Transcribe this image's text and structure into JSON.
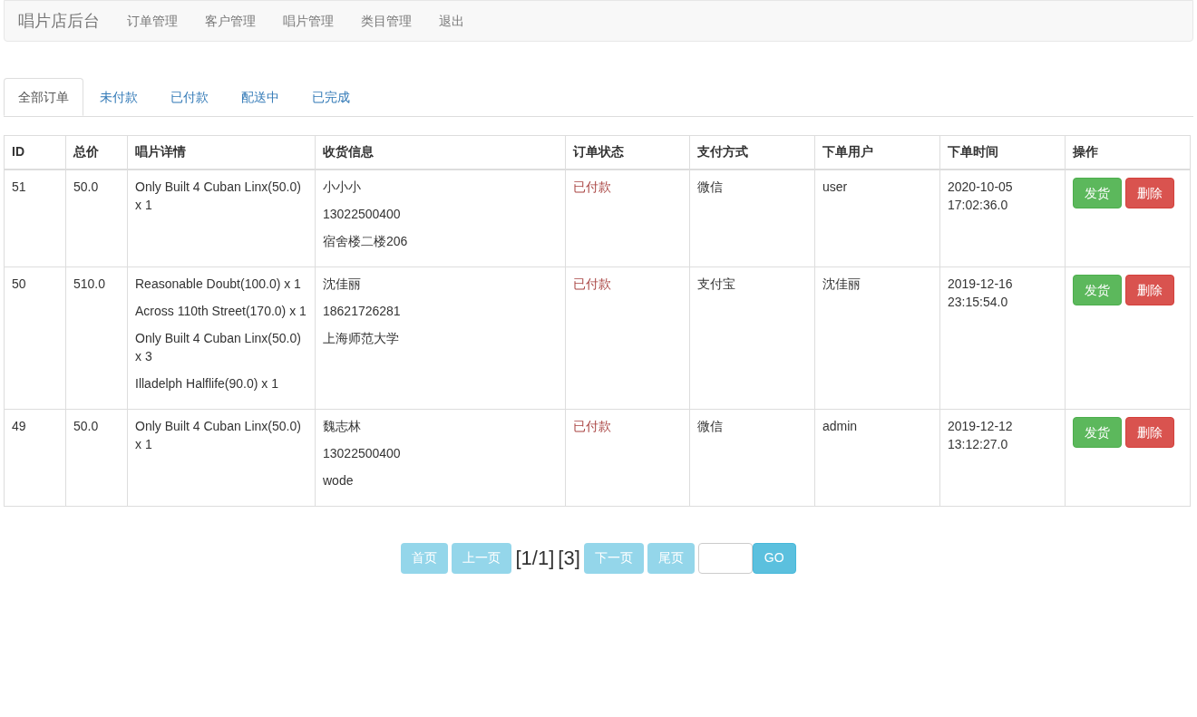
{
  "navbar": {
    "brand": "唱片店后台",
    "links": [
      "订单管理",
      "客户管理",
      "唱片管理",
      "类目管理",
      "退出"
    ]
  },
  "tabs": [
    {
      "label": "全部订单",
      "selected": true
    },
    {
      "label": "未付款",
      "selected": false
    },
    {
      "label": "已付款",
      "selected": false
    },
    {
      "label": "配送中",
      "selected": false
    },
    {
      "label": "已完成",
      "selected": false
    }
  ],
  "table": {
    "columns": [
      "ID",
      "总价",
      "唱片详情",
      "收货信息",
      "订单状态",
      "支付方式",
      "下单用户",
      "下单时间",
      "操作"
    ],
    "rows": [
      {
        "id": "51",
        "total": "50.0",
        "items": [
          "Only Built 4 Cuban Linx(50.0) x 1"
        ],
        "shipping": [
          "小小小",
          "13022500400",
          "宿舍楼二楼206"
        ],
        "status": "已付款",
        "payment": "微信",
        "user": "user",
        "time": "2020-10-05 17:02:36.0",
        "actions": [
          "发货",
          "删除"
        ]
      },
      {
        "id": "50",
        "total": "510.0",
        "items": [
          "Reasonable Doubt(100.0) x 1",
          "Across 110th Street(170.0) x 1",
          "Only Built 4 Cuban Linx(50.0) x 3",
          "Illadelph Halflife(90.0) x 1"
        ],
        "shipping": [
          "沈佳丽",
          "18621726281",
          "上海师范大学"
        ],
        "status": "已付款",
        "payment": "支付宝",
        "user": "沈佳丽",
        "time": "2019-12-16 23:15:54.0",
        "actions": [
          "发货",
          "删除"
        ]
      },
      {
        "id": "49",
        "total": "50.0",
        "items": [
          "Only Built 4 Cuban Linx(50.0) x 1"
        ],
        "shipping": [
          "魏志林",
          "13022500400",
          "wode"
        ],
        "status": "已付款",
        "payment": "微信",
        "user": "admin",
        "time": "2019-12-12 13:12:27.0",
        "actions": [
          "发货",
          "删除"
        ]
      }
    ]
  },
  "pagination": {
    "buttons": [
      {
        "label": "首页",
        "disabled": true
      },
      {
        "label": "上一页",
        "disabled": true
      }
    ],
    "page_info": "[1/1]",
    "count": "[3]",
    "buttons_after": [
      {
        "label": "下一页",
        "disabled": true
      },
      {
        "label": "尾页",
        "disabled": true
      }
    ],
    "go_button": "GO"
  }
}
